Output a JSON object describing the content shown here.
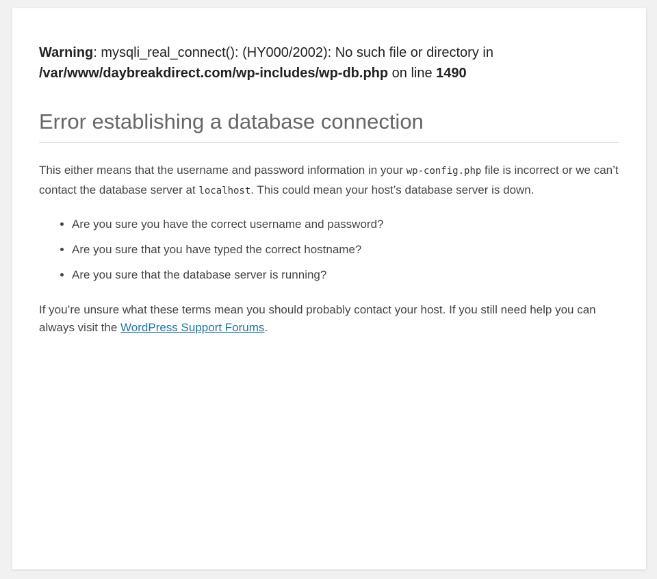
{
  "warning": {
    "label": "Warning",
    "message": ": mysqli_real_connect(): (HY000/2002): No such file or directory in ",
    "file_path": "/var/www/daybreakdirect.com/wp-includes/wp-db.php",
    "on_line_text": " on line ",
    "line_number": "1490"
  },
  "error": {
    "heading": "Error establishing a database connection",
    "explanation": {
      "part1": "This either means that the username and password information in your ",
      "config_file": "wp-config.php",
      "part2": " file is incorrect or we can’t contact the database server at ",
      "host": "localhost",
      "part3": ". This could mean your host’s database server is down."
    },
    "checklist": [
      "Are you sure you have the correct username and password?",
      "Are you sure that you have typed the correct hostname?",
      "Are you sure that the database server is running?"
    ],
    "help": {
      "before_link": "If you’re unsure what these terms mean you should probably contact your host. If you still need help you can always visit the ",
      "link_text": "WordPress Support Forums",
      "after_link": "."
    }
  },
  "colors": {
    "page_background": "#f1f1f1",
    "card_background": "#ffffff",
    "link": "#21759b",
    "heading": "#666666",
    "divider": "#dadada"
  }
}
